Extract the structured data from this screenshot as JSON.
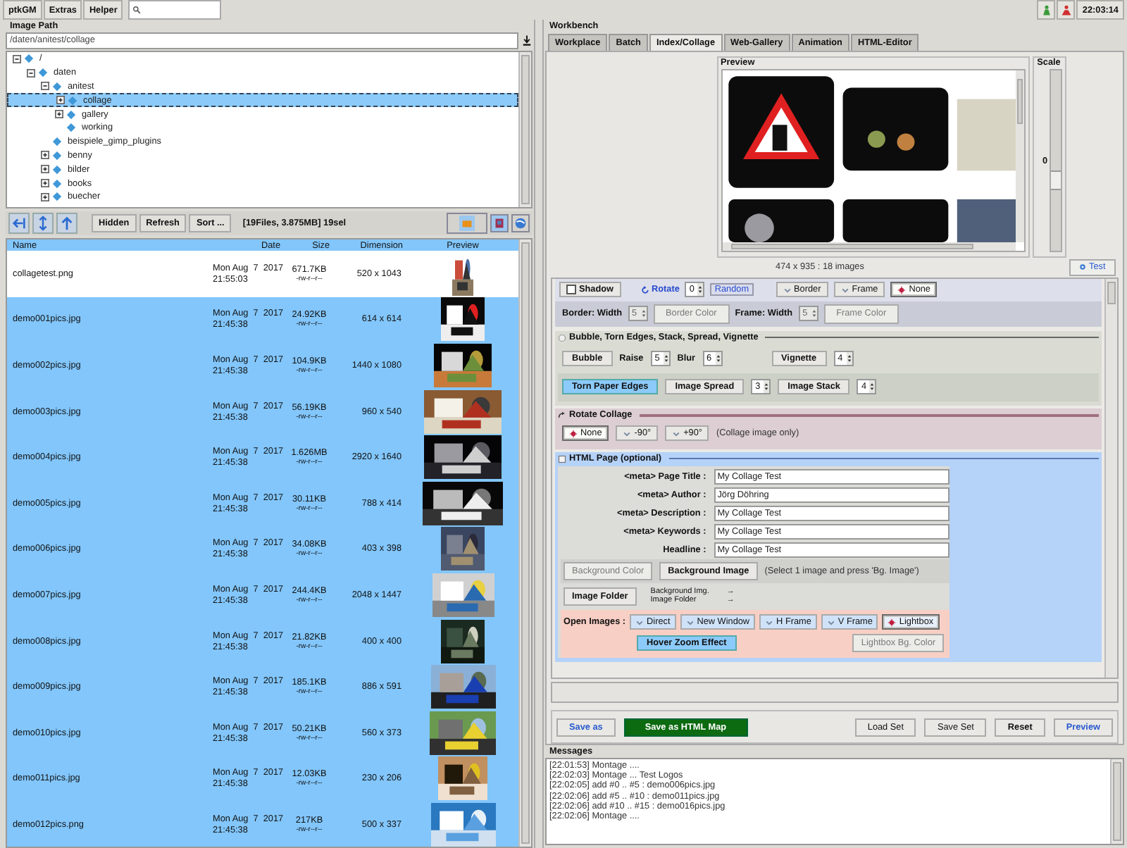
{
  "menu": [
    "ptkGM",
    "Extras",
    "Helper"
  ],
  "clock": "22:03:14",
  "image_path": {
    "title": "Image Path",
    "path": "/daten/anitest/collage"
  },
  "tree": [
    {
      "label": "/",
      "expanded": true,
      "selected": false,
      "children": [
        {
          "label": "daten",
          "expanded": true,
          "selected": false,
          "children": [
            {
              "label": "anitest",
              "expanded": true,
              "selected": false,
              "children": [
                {
                  "label": "collage",
                  "expanded": false,
                  "selected": true
                },
                {
                  "label": "gallery",
                  "expanded": false,
                  "selected": false
                },
                {
                  "label": "working",
                  "selected": false
                }
              ]
            },
            {
              "label": "beispiele_gimp_plugins",
              "selected": false
            },
            {
              "label": "benny",
              "expanded": false,
              "selected": false
            },
            {
              "label": "bilder",
              "expanded": false,
              "selected": false
            },
            {
              "label": "books",
              "expanded": false,
              "selected": false
            },
            {
              "label": "buecher",
              "expanded": false,
              "selected": false
            }
          ]
        }
      ]
    }
  ],
  "file_toolbar": {
    "buttons": [
      "Hidden",
      "Refresh",
      "Sort ..."
    ],
    "summary": "[19Files, 3.875MB] 19sel"
  },
  "file_list": {
    "columns": [
      "Name",
      "Date",
      "Size",
      "Dimension",
      "Preview"
    ],
    "rows": [
      {
        "name": "collagetest.png",
        "date": "Mon Aug  7  2017",
        "time": "21:55:03",
        "size": "671.7KB",
        "perms": "-rw-r--r--",
        "dimension": "520 x 1043",
        "selected": false
      },
      {
        "name": "demo001pics.jpg",
        "date": "Mon Aug  7  2017",
        "time": "21:45:38",
        "size": "24.92KB",
        "perms": "-rw-r--r--",
        "dimension": "614 x 614",
        "selected": true
      },
      {
        "name": "demo002pics.jpg",
        "date": "Mon Aug  7  2017",
        "time": "21:45:38",
        "size": "104.9KB",
        "perms": "-rw-r--r--",
        "dimension": "1440 x 1080",
        "selected": true
      },
      {
        "name": "demo003pics.jpg",
        "date": "Mon Aug  7  2017",
        "time": "21:45:38",
        "size": "56.19KB",
        "perms": "-rw-r--r--",
        "dimension": "960 x 540",
        "selected": true
      },
      {
        "name": "demo004pics.jpg",
        "date": "Mon Aug  7  2017",
        "time": "21:45:38",
        "size": "1.626MB",
        "perms": "-rw-r--r--",
        "dimension": "2920 x 1640",
        "selected": true
      },
      {
        "name": "demo005pics.jpg",
        "date": "Mon Aug  7  2017",
        "time": "21:45:38",
        "size": "30.11KB",
        "perms": "-rw-r--r--",
        "dimension": "788 x 414",
        "selected": true
      },
      {
        "name": "demo006pics.jpg",
        "date": "Mon Aug  7  2017",
        "time": "21:45:38",
        "size": "34.08KB",
        "perms": "-rw-r--r--",
        "dimension": "403 x 398",
        "selected": true
      },
      {
        "name": "demo007pics.jpg",
        "date": "Mon Aug  7  2017",
        "time": "21:45:38",
        "size": "244.4KB",
        "perms": "-rw-r--r--",
        "dimension": "2048 x 1447",
        "selected": true
      },
      {
        "name": "demo008pics.jpg",
        "date": "Mon Aug  7  2017",
        "time": "21:45:38",
        "size": "21.82KB",
        "perms": "-rw-r--r--",
        "dimension": "400 x 400",
        "selected": true
      },
      {
        "name": "demo009pics.jpg",
        "date": "Mon Aug  7  2017",
        "time": "21:45:38",
        "size": "185.1KB",
        "perms": "-rw-r--r--",
        "dimension": "886 x 591",
        "selected": true
      },
      {
        "name": "demo010pics.jpg",
        "date": "Mon Aug  7  2017",
        "time": "21:45:38",
        "size": "50.21KB",
        "perms": "-rw-r--r--",
        "dimension": "560 x 373",
        "selected": true
      },
      {
        "name": "demo011pics.jpg",
        "date": "Mon Aug  7  2017",
        "time": "21:45:38",
        "size": "12.03KB",
        "perms": "-rw-r--r--",
        "dimension": "230 x 206",
        "selected": true
      },
      {
        "name": "demo012pics.png",
        "date": "Mon Aug  7  2017",
        "time": "21:45:38",
        "size": "217KB",
        "perms": "-rw-r--r--",
        "dimension": "500 x 337",
        "selected": true
      }
    ]
  },
  "workbench": {
    "title": "Workbench",
    "tabs": [
      {
        "label": "Workplace",
        "selected": false
      },
      {
        "label": "Batch",
        "selected": false
      },
      {
        "label": "Index/Collage",
        "selected": true
      },
      {
        "label": "Web-Gallery",
        "selected": false
      },
      {
        "label": "Animation",
        "selected": false
      },
      {
        "label": "HTML-Editor",
        "selected": false
      }
    ]
  },
  "preview": {
    "title": "Preview",
    "info": "474 x 935 : 18 images"
  },
  "scale": {
    "title": "Scale",
    "value": "0",
    "level": 0.6
  },
  "test_button": "Test",
  "shadow": {
    "label": "Shadow",
    "checked": false
  },
  "rotate": {
    "label": "Rotate",
    "value": "0",
    "random": "Random"
  },
  "frame_modes": [
    {
      "label": "Border",
      "selected": false
    },
    {
      "label": "Frame",
      "selected": false
    },
    {
      "label": "None",
      "selected": true
    }
  ],
  "border_row": [
    {
      "kind": "label",
      "text": "Border: Width"
    },
    {
      "kind": "spin",
      "value": "5",
      "disabled": true
    },
    {
      "kind": "button",
      "label": "Border Color",
      "disabled": true
    },
    {
      "kind": "label",
      "text": "Frame: Width"
    },
    {
      "kind": "spin",
      "value": "5",
      "disabled": true
    },
    {
      "kind": "button",
      "label": "Frame Color",
      "disabled": true
    }
  ],
  "effects_group": {
    "title": "Bubble, Torn Edges, Stack, Spread, Vignette",
    "checked": false,
    "upper_line": [
      {
        "kind": "toggle",
        "label": "Bubble",
        "on": false
      },
      {
        "kind": "label",
        "text": "Raise"
      },
      {
        "kind": "spin",
        "value": "5",
        "disabled": false
      },
      {
        "kind": "label",
        "text": "Blur"
      },
      {
        "kind": "spin",
        "value": "6",
        "disabled": false
      },
      {
        "kind": "toggle",
        "label": "Vignette",
        "on": false
      },
      {
        "kind": "spin",
        "value": "4",
        "disabled": false
      }
    ],
    "lower_line": [
      {
        "kind": "toggle",
        "label": "Torn Paper Edges",
        "on": true
      },
      {
        "kind": "toggle",
        "label": "Image Spread",
        "on": false
      },
      {
        "kind": "spin",
        "value": "3",
        "disabled": false
      },
      {
        "kind": "toggle",
        "label": "Image Stack",
        "on": false
      },
      {
        "kind": "spin",
        "value": "4",
        "disabled": false
      }
    ]
  },
  "rotate_collage": {
    "title": "Rotate Collage",
    "options": [
      {
        "label": "None",
        "selected": true
      },
      {
        "label": "-90°",
        "selected": false
      },
      {
        "label": "+90°",
        "selected": false
      }
    ],
    "note": "(Collage image only)"
  },
  "html_page": {
    "title": "HTML Page (optional)",
    "checked": false,
    "fields": [
      {
        "label": "<meta> Page Title :",
        "value": "My Collage Test"
      },
      {
        "label": "<meta> Author :",
        "value": "Jörg Döhring"
      },
      {
        "label": "<meta> Description :",
        "value": "My Collage Test"
      },
      {
        "label": "<meta> Keywords :",
        "value": "My Collage Test"
      },
      {
        "label": "Headline :",
        "value": "My Collage Test"
      }
    ],
    "background_buttons": [
      {
        "label": "Background Color",
        "disabled": true
      },
      {
        "label": "Background Image",
        "disabled": false
      }
    ],
    "background_note": "(Select 1 image and press 'Bg. Image')",
    "folder_button": "Image Folder",
    "targets": [
      {
        "label": "Background Img.",
        "arrow": "→"
      },
      {
        "label": "Image Folder",
        "arrow": "→"
      }
    ],
    "open_images": {
      "label": "Open Images :",
      "options": [
        {
          "label": "Direct",
          "selected": false
        },
        {
          "label": "New Window",
          "selected": false
        },
        {
          "label": "H Frame",
          "selected": false
        },
        {
          "label": "V Frame",
          "selected": false
        },
        {
          "label": "Lightbox",
          "selected": true
        }
      ]
    },
    "hover_zoom": {
      "label": "Hover Zoom Effect",
      "on": true
    },
    "lightbox_color": {
      "label": "Lightbox Bg. Color",
      "disabled": true
    }
  },
  "actions": [
    {
      "label": "Save as",
      "kind": "link"
    },
    {
      "label": "Save as HTML Map",
      "kind": "accent"
    },
    {
      "label": "Load Set",
      "kind": "plain"
    },
    {
      "label": "Save Set",
      "kind": "plain"
    },
    {
      "label": "Reset",
      "kind": "strong"
    },
    {
      "label": "Preview",
      "kind": "link"
    }
  ],
  "messages": {
    "title": "Messages",
    "lines": [
      "[22:01:53] Montage ....",
      "[22:02:03] Montage ... Test Logos",
      "[22:02:05] add #0 .. #5 : demo006pics.jpg",
      "[22:02:06] add #5 .. #10 : demo011pics.jpg",
      "[22:02:06] add #10 .. #15 : demo016pics.jpg",
      "[22:02:06] Montage ...."
    ]
  }
}
